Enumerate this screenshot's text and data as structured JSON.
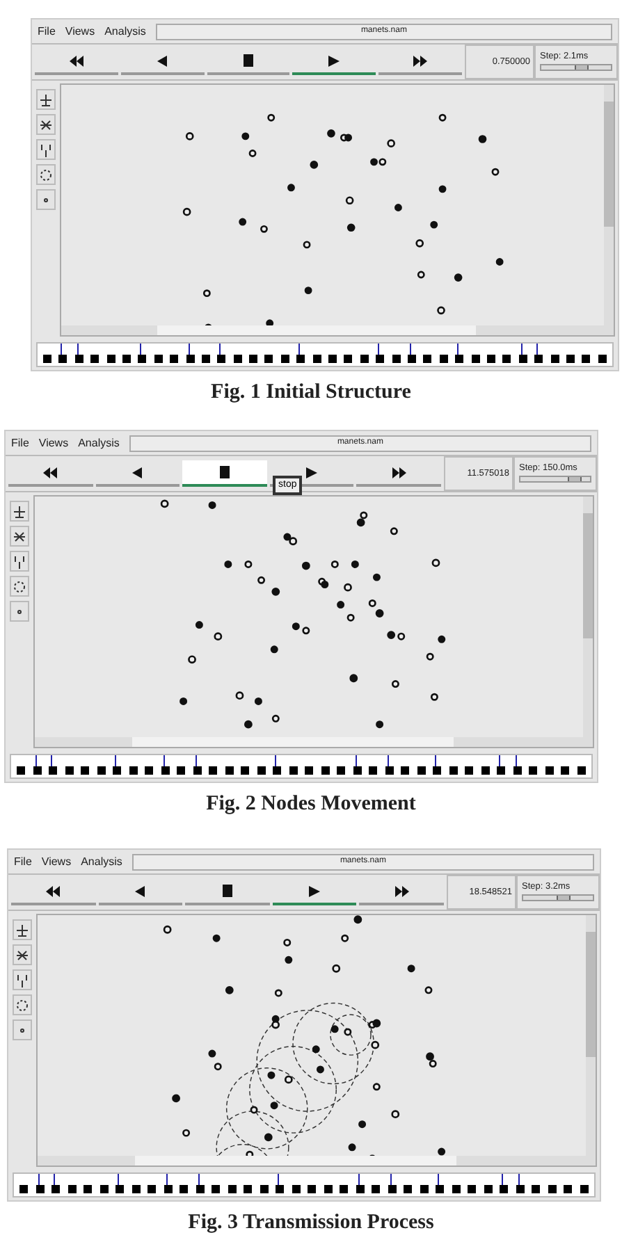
{
  "figures": [
    {
      "menus": [
        "File",
        "Views",
        "Analysis"
      ],
      "file_title": "manets.nam",
      "buttons": [
        {
          "kind": "rewind",
          "selected": false
        },
        {
          "kind": "back",
          "selected": false
        },
        {
          "kind": "stop",
          "selected": false
        },
        {
          "kind": "play",
          "selected": true
        },
        {
          "kind": "forward",
          "selected": false
        }
      ],
      "time": "0.750000",
      "step": {
        "label": "Step: 2.1ms",
        "level": 0.6
      },
      "caption": "Fig. 1 Initial Structure"
    },
    {
      "menus": [
        "File",
        "Views",
        "Analysis"
      ],
      "file_title": "manets.nam",
      "buttons": [
        {
          "kind": "rewind",
          "selected": false
        },
        {
          "kind": "back",
          "selected": false
        },
        {
          "kind": "stop",
          "selected": true
        },
        {
          "kind": "play",
          "selected": false
        },
        {
          "kind": "forward",
          "selected": false
        }
      ],
      "tooltip": "stop",
      "time": "11.575018",
      "step": {
        "label": "Step: 150.0ms",
        "level": 0.85
      },
      "caption": "Fig. 2 Nodes Movement"
    },
    {
      "menus": [
        "File",
        "Views",
        "Analysis"
      ],
      "file_title": "manets.nam",
      "buttons": [
        {
          "kind": "rewind",
          "selected": false
        },
        {
          "kind": "back",
          "selected": false
        },
        {
          "kind": "stop",
          "selected": false
        },
        {
          "kind": "play",
          "selected": true
        },
        {
          "kind": "forward",
          "selected": false
        }
      ],
      "time": "18.548521",
      "step": {
        "label": "Step: 3.2ms",
        "level": 0.6
      },
      "caption": "Fig. 3 Transmission Process"
    }
  ]
}
